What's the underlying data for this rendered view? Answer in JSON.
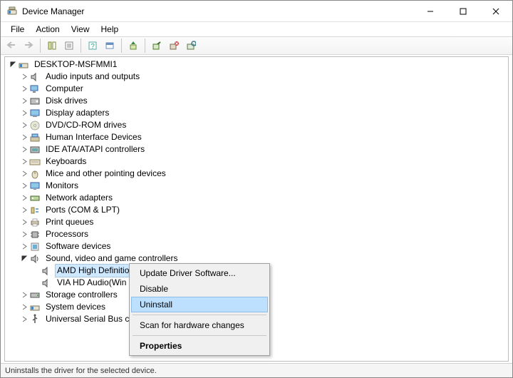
{
  "window": {
    "title": "Device Manager"
  },
  "menu": {
    "items": [
      "File",
      "Action",
      "View",
      "Help"
    ]
  },
  "tree": {
    "root": "DESKTOP-MSFMMI1",
    "categories": [
      "Audio inputs and outputs",
      "Computer",
      "Disk drives",
      "Display adapters",
      "DVD/CD-ROM drives",
      "Human Interface Devices",
      "IDE ATA/ATAPI controllers",
      "Keyboards",
      "Mice and other pointing devices",
      "Monitors",
      "Network adapters",
      "Ports (COM & LPT)",
      "Print queues",
      "Processors",
      "Software devices",
      "Sound, video and game controllers",
      "Storage controllers",
      "System devices",
      "Universal Serial Bus co"
    ],
    "sound_children": [
      "AMD High Definition Audio Device",
      "VIA HD Audio(Win"
    ],
    "selected": "AMD High Definition Audio Device"
  },
  "context_menu": {
    "items": {
      "update": "Update Driver Software...",
      "disable": "Disable",
      "uninstall": "Uninstall",
      "scan": "Scan for hardware changes",
      "properties": "Properties"
    },
    "highlighted": "uninstall"
  },
  "statusbar": {
    "text": "Uninstalls the driver for the selected device."
  }
}
